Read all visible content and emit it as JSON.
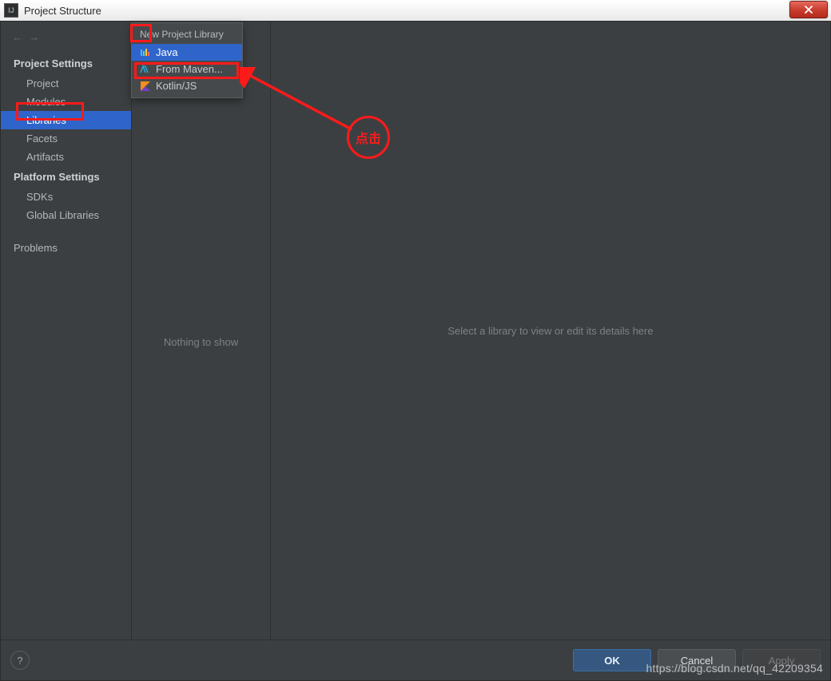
{
  "window": {
    "title": "Project Structure",
    "app_icon_text": "IJ",
    "close_label": "X"
  },
  "sidebar": {
    "nav_back": "←",
    "nav_forward": "→",
    "headings": {
      "project_settings": "Project Settings",
      "platform_settings": "Platform Settings"
    },
    "items": {
      "project": "Project",
      "modules": "Modules",
      "libraries": "Libraries",
      "facets": "Facets",
      "artifacts": "Artifacts",
      "sdks": "SDKs",
      "global_libraries": "Global Libraries",
      "problems": "Problems"
    }
  },
  "mid": {
    "add_label": "+",
    "remove_label": "−",
    "copy_label": "⧉",
    "empty_text": "Nothing to show"
  },
  "popup": {
    "title": "New Project Library",
    "items": {
      "java": "Java",
      "from_maven": "From Maven...",
      "kotlinjs": "Kotlin/JS"
    }
  },
  "detail": {
    "placeholder": "Select a library to view or edit its details here"
  },
  "footer": {
    "help": "?",
    "ok": "OK",
    "cancel": "Cancel",
    "apply": "Apply"
  },
  "annotation": {
    "callout": "点击"
  },
  "watermark": "https://blog.csdn.net/qq_42209354"
}
